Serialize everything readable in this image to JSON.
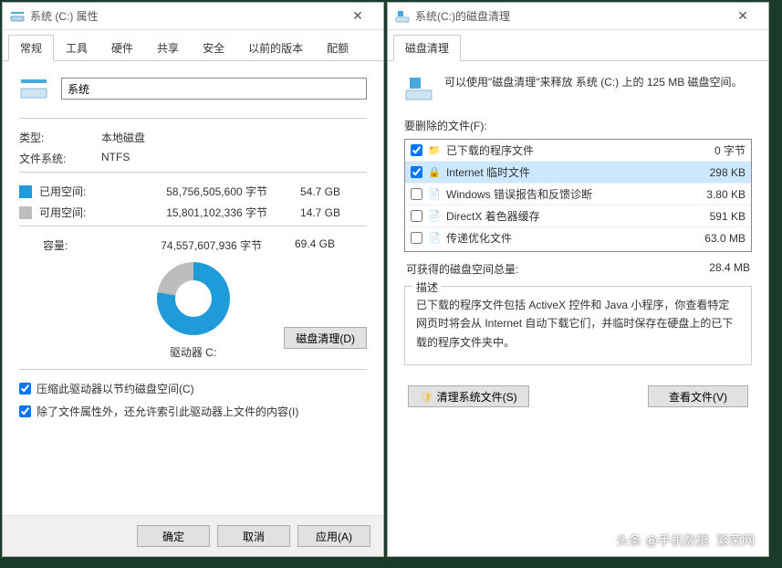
{
  "props": {
    "title": "系统 (C:) 属性",
    "tabs": [
      "常规",
      "工具",
      "硬件",
      "共享",
      "安全",
      "以前的版本",
      "配额"
    ],
    "drive_name": "系统",
    "type_label": "类型:",
    "type_value": "本地磁盘",
    "fs_label": "文件系统:",
    "fs_value": "NTFS",
    "used_label": "已用空间:",
    "used_bytes": "58,756,505,600 字节",
    "used_gb": "54.7 GB",
    "free_label": "可用空间:",
    "free_bytes": "15,801,102,336 字节",
    "free_gb": "14.7 GB",
    "cap_label": "容量:",
    "cap_bytes": "74,557,607,936 字节",
    "cap_gb": "69.4 GB",
    "drive_letter": "驱动器 C:",
    "cleanup_btn": "磁盘清理(D)",
    "chk_compress": "压缩此驱动器以节约磁盘空间(C)",
    "chk_index": "除了文件属性外，还允许索引此驱动器上文件的内容(I)",
    "footer": {
      "ok": "确定",
      "cancel": "取消",
      "apply": "应用(A)"
    }
  },
  "clean": {
    "title": "系统(C:)的磁盘清理",
    "tabs": [
      "磁盘清理"
    ],
    "info": "可以使用\"磁盘清理\"来释放 系统 (C:) 上的 125 MB 磁盘空间。",
    "files_label": "要删除的文件(F):",
    "files": [
      {
        "checked": true,
        "name": "已下载的程序文件",
        "size": "0 字节",
        "icon": "folder"
      },
      {
        "checked": true,
        "name": "Internet 临时文件",
        "size": "298 KB",
        "icon": "lock"
      },
      {
        "checked": false,
        "name": "Windows 错误报告和反馈诊断",
        "size": "3.80 KB",
        "icon": "file"
      },
      {
        "checked": false,
        "name": "DirectX 着色器缓存",
        "size": "591 KB",
        "icon": "file"
      },
      {
        "checked": false,
        "name": "传递优化文件",
        "size": "63.0 MB",
        "icon": "file"
      }
    ],
    "total_label": "可获得的磁盘空间总量:",
    "total_value": "28.4 MB",
    "desc_legend": "描述",
    "desc_text": "已下载的程序文件包括 ActiveX 控件和 Java 小程序，你查看特定网页时将会从 Internet 自动下载它们，并临时保存在硬盘上的已下载的程序文件夹中。",
    "sys_clean_btn": "清理系统文件(S)",
    "view_files_btn": "查看文件(V)"
  },
  "watermark1": "头条 @手机数摄",
  "watermark2": "繁荣网"
}
